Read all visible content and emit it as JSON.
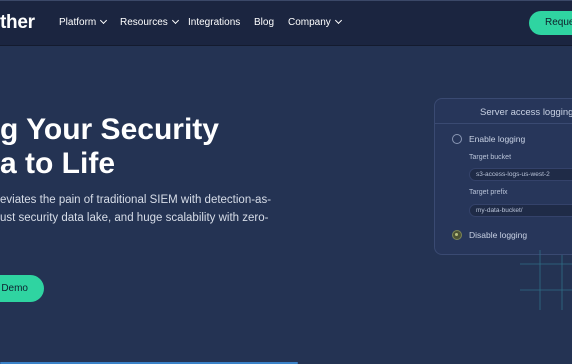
{
  "header": {
    "logo_text": "ther",
    "nav": [
      {
        "label": "Platform",
        "has_dropdown": true
      },
      {
        "label": "Resources",
        "has_dropdown": true
      },
      {
        "label": "Integrations",
        "has_dropdown": false
      },
      {
        "label": "Blog",
        "has_dropdown": false
      },
      {
        "label": "Company",
        "has_dropdown": true
      }
    ],
    "cta_label": "Reque"
  },
  "hero": {
    "headline_line1": "g Your Security",
    "headline_line2": "a to Life",
    "desc_line1": "eviates the pain of traditional SIEM with detection-as-",
    "desc_line2": "ust security data lake, and huge scalability with zero-",
    "demo_label": "Demo"
  },
  "card": {
    "title": "Server access logging",
    "enable_label": "Enable logging",
    "target_bucket_label": "Target bucket",
    "target_bucket_value": "s3-access-logs-us-west-2",
    "target_prefix_label": "Target prefix",
    "target_prefix_value": "my-data-bucket/",
    "disable_label": "Disable logging",
    "selected": "disable"
  },
  "colors": {
    "background": "#243353",
    "header": "#1b2540",
    "accent": "#2fd4a1",
    "card": "#27365a"
  }
}
